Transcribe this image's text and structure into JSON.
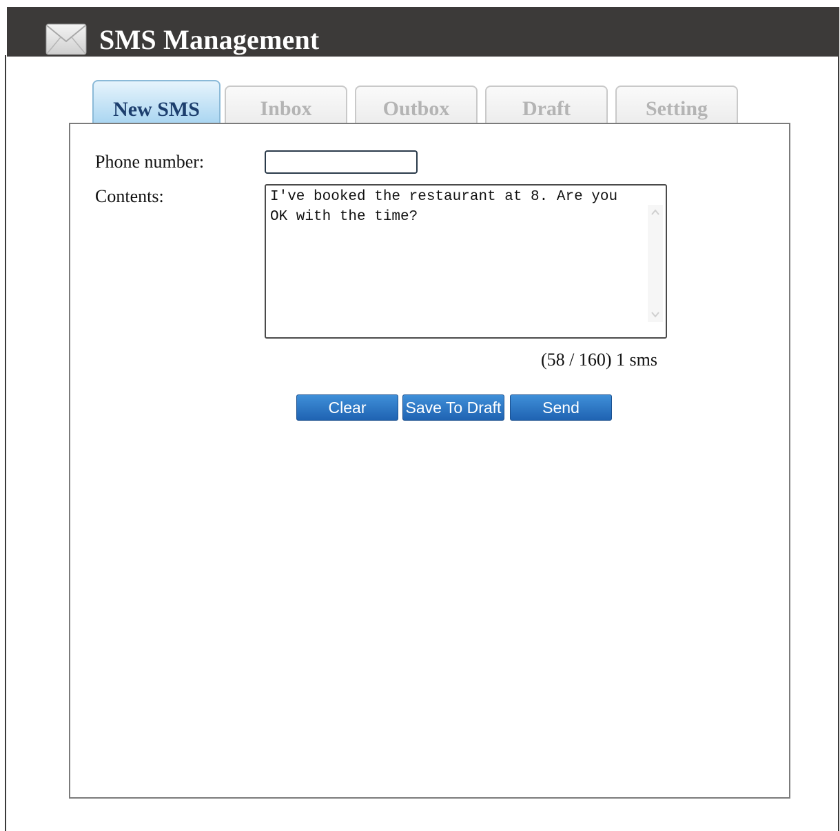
{
  "app": {
    "title": "SMS Management",
    "icon": "envelope-icon"
  },
  "tabs": [
    {
      "label": "New SMS",
      "active": true
    },
    {
      "label": "Inbox",
      "active": false
    },
    {
      "label": "Outbox",
      "active": false
    },
    {
      "label": "Draft",
      "active": false
    },
    {
      "label": "Setting",
      "active": false
    }
  ],
  "form": {
    "phone_label": "Phone number:",
    "phone_value": "",
    "phone_placeholder": "",
    "contents_label": "Contents:",
    "contents_value": "I've booked the restaurant at 8. Are you OK with the time?",
    "counter": "(58 / 160) 1 sms"
  },
  "buttons": {
    "clear": "Clear",
    "save_draft": "Save To Draft",
    "send": "Send"
  },
  "colors": {
    "titlebar": "#3c3a39",
    "button": "#2a76c6",
    "active_tab": "#a9d5f1"
  }
}
